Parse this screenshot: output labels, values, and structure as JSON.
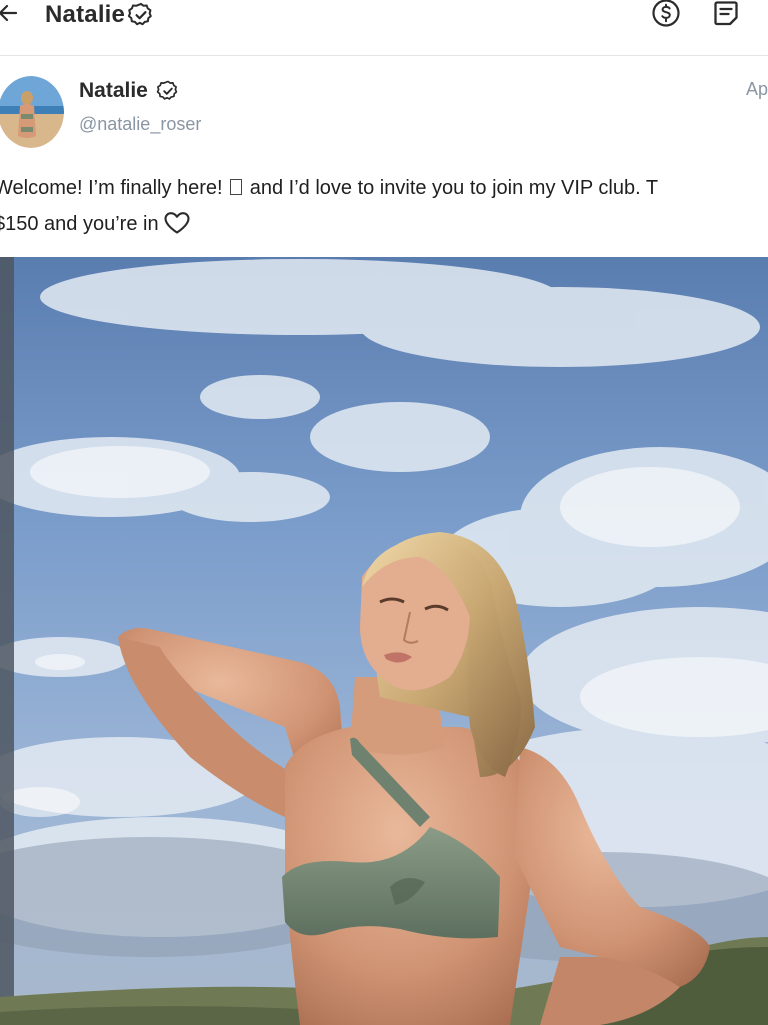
{
  "header": {
    "title": "Natalie",
    "back_icon": "arrow-left-icon",
    "verified_icon": "verified-badge-icon",
    "tip_icon": "dollar-circle-icon",
    "notes_icon": "note-icon"
  },
  "post": {
    "author_name": "Natalie",
    "author_handle": "@natalie_roser",
    "date_fragment": "Ap",
    "text_line1_part1": "Welcome! I’m finally here!",
    "text_line1_part2": "and I’d love to invite you to join my VIP club. T",
    "text_line2": "$150 and you’re in",
    "heart_icon": "heart-outline-icon",
    "photo_description_icon": "photo"
  },
  "colors": {
    "muted": "#8a96a3",
    "text": "#1f1f1f",
    "divider": "#e6e6e6"
  }
}
